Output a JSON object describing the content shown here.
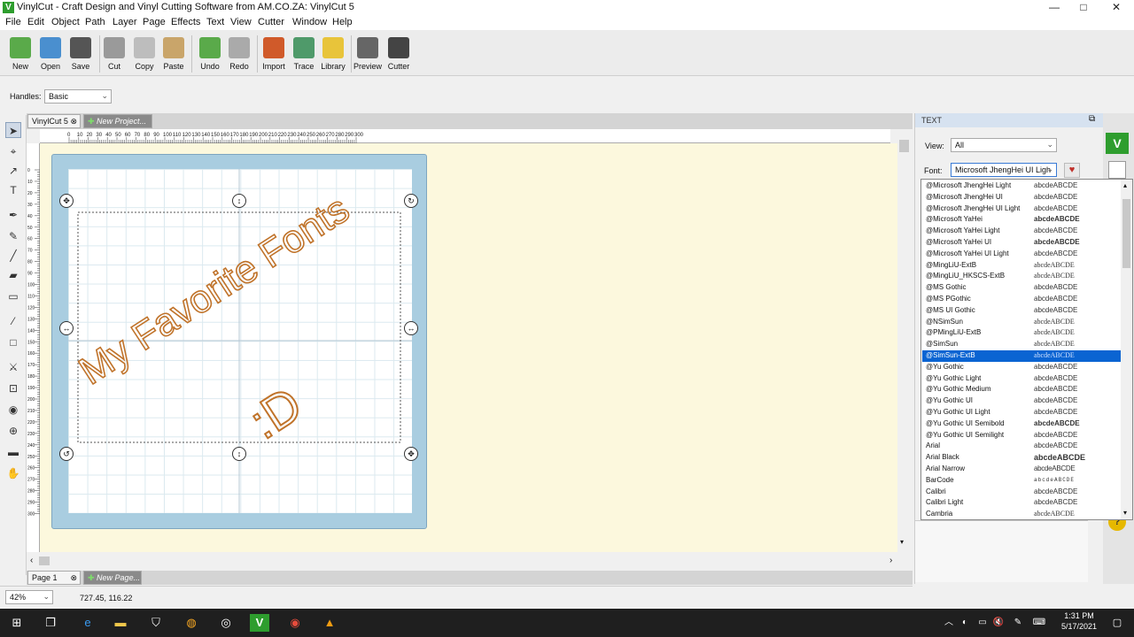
{
  "window": {
    "title": "VinylCut - Craft Design and Vinyl Cutting Software from AM.CO.ZA: VinylCut 5",
    "controls": {
      "minimize": "—",
      "maximize": "□",
      "close": "✕"
    }
  },
  "menu": [
    "File",
    "Edit",
    "Object",
    "Path",
    "Layer",
    "Page",
    "Effects",
    "Text",
    "View",
    "Cutter",
    "Window",
    "Help"
  ],
  "toolbar": [
    {
      "label": "New",
      "color": "#5aaa4a"
    },
    {
      "label": "Open",
      "color": "#4a8fcf"
    },
    {
      "label": "Save",
      "color": "#555"
    },
    {
      "label": "Cut",
      "color": "#9a9a9a"
    },
    {
      "label": "Copy",
      "color": "#bdbdbd"
    },
    {
      "label": "Paste",
      "color": "#c9a56a"
    },
    {
      "label": "Undo",
      "color": "#5aaa4a"
    },
    {
      "label": "Redo",
      "color": "#aaaaaa"
    },
    {
      "label": "Import",
      "color": "#d05a2a"
    },
    {
      "label": "Trace",
      "color": "#4f9a6a"
    },
    {
      "label": "Library",
      "color": "#e8c43a"
    },
    {
      "label": "Preview",
      "color": "#666"
    },
    {
      "label": "Cutter",
      "color": "#444"
    }
  ],
  "handles": {
    "label": "Handles:",
    "value": "Basic"
  },
  "tabs": {
    "active": "VinylCut 5",
    "new": "New Project..."
  },
  "design": {
    "text_line": "My Favorite Fonts",
    "text_face": ":D"
  },
  "pagetabs": {
    "active": "Page 1",
    "new": "New Page..."
  },
  "status": {
    "zoom": "42%",
    "coords": "727.45, 116.22"
  },
  "panel": {
    "title": "TEXT",
    "view_label": "View:",
    "view_value": "All",
    "font_label": "Font:",
    "font_value": "Microsoft JhengHei UI Ligh"
  },
  "font_sample": "abcdeABCDE",
  "fonts": [
    "@Microsoft JhengHei Light",
    "@Microsoft JhengHei UI",
    "@Microsoft JhengHei UI Light",
    "@Microsoft YaHei",
    "@Microsoft YaHei Light",
    "@Microsoft YaHei UI",
    "@Microsoft YaHei UI Light",
    "@MingLiU-ExtB",
    "@MingLiU_HKSCS-ExtB",
    "@MS Gothic",
    "@MS PGothic",
    "@MS UI Gothic",
    "@NSimSun",
    "@PMingLiU-ExtB",
    "@SimSun",
    "@SimSun-ExtB",
    "@Yu Gothic",
    "@Yu Gothic Light",
    "@Yu Gothic Medium",
    "@Yu Gothic UI",
    "@Yu Gothic UI Light",
    "@Yu Gothic UI Semibold",
    "@Yu Gothic UI Semilight",
    "Arial",
    "Arial Black",
    "Arial Narrow",
    "BarCode",
    "Calibri",
    "Calibri Light",
    "Cambria"
  ],
  "selected_font": "@SimSun-ExtB",
  "ruler_top": [
    "0",
    "10",
    "20",
    "30",
    "40",
    "50",
    "60",
    "70",
    "80",
    "90",
    "100",
    "110",
    "120",
    "130",
    "140",
    "150",
    "160",
    "170",
    "180",
    "190",
    "200",
    "210",
    "220",
    "230",
    "240",
    "250",
    "260",
    "270",
    "280",
    "290",
    "300"
  ],
  "ruler_left": [
    "0",
    "10",
    "20",
    "30",
    "40",
    "50",
    "60",
    "70",
    "80",
    "90",
    "100",
    "110",
    "120",
    "130",
    "140",
    "150",
    "160",
    "170",
    "180",
    "190",
    "200",
    "210",
    "220",
    "230",
    "240",
    "250",
    "260",
    "270",
    "280",
    "290",
    "300"
  ],
  "taskbar": {
    "time": "1:31 PM",
    "date": "5/17/2021"
  }
}
